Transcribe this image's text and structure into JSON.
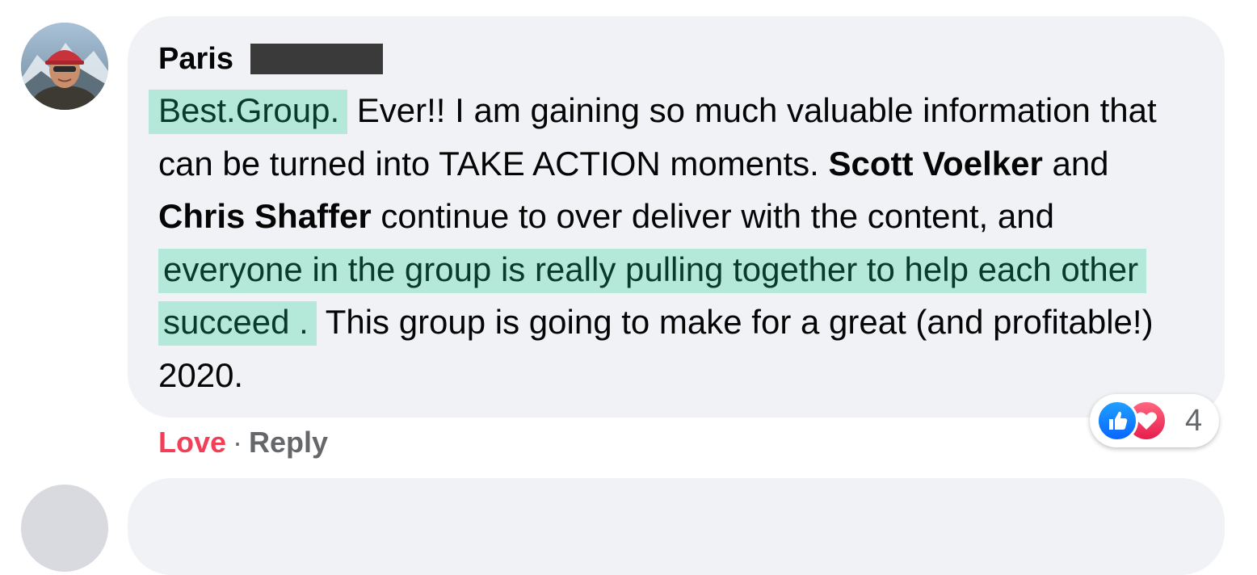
{
  "comment": {
    "author": "Paris",
    "text_segments": {
      "hl1": "Best.Group.",
      "t1": " Ever!! I am gaining so much valuable information that can be turned into TAKE ACTION moments. ",
      "name1": "Scott Voelker",
      "t2": " and ",
      "name2": "Chris Shaffer",
      "t3": " continue to over deliver with the content, and ",
      "hl2": "everyone in the group is really pulling together to help each other succeed .",
      "t4": " This group is going to make for a great (and profitable!) 2020."
    },
    "reactions": {
      "icons": [
        "like-icon",
        "love-icon"
      ],
      "count": "4"
    },
    "actions": {
      "love_label": "Love",
      "separator": "·",
      "reply_label": "Reply"
    }
  },
  "colors": {
    "bubble": "#f0f2f5",
    "highlight": "#b4e8d8",
    "love": "#f33e58",
    "like": "#0866ff",
    "muted": "#65676b"
  }
}
